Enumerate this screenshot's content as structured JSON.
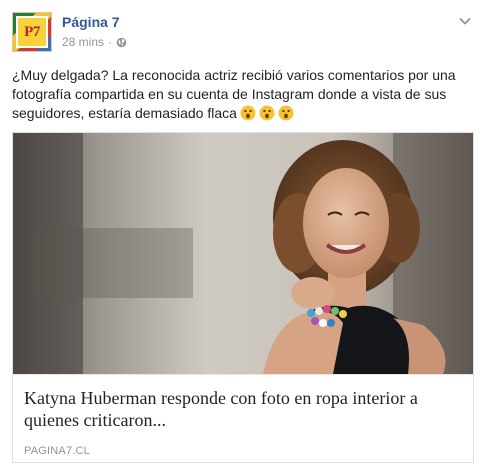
{
  "post": {
    "page_name": "Página 7",
    "avatar_text": "P7",
    "timestamp": "28 mins",
    "separator": "·",
    "message": "¿Muy delgada? La reconocida actriz recibió varios comentarios por una fotografía compartida en su cuenta de Instagram donde a vista de sus seguidores, estaría demasiado flaca",
    "emojis": [
      "surprised-face-emoji",
      "surprised-face-emoji",
      "surprised-face-emoji"
    ]
  },
  "link_card": {
    "title": "Katyna Huberman responde con foto en ropa interior a quienes criticaron...",
    "domain": "PAGINA7.CL"
  },
  "colors": {
    "page_name": "#365899",
    "meta_text": "#90949c",
    "body_text": "#1d2129",
    "card_border": "#dddfe2"
  }
}
